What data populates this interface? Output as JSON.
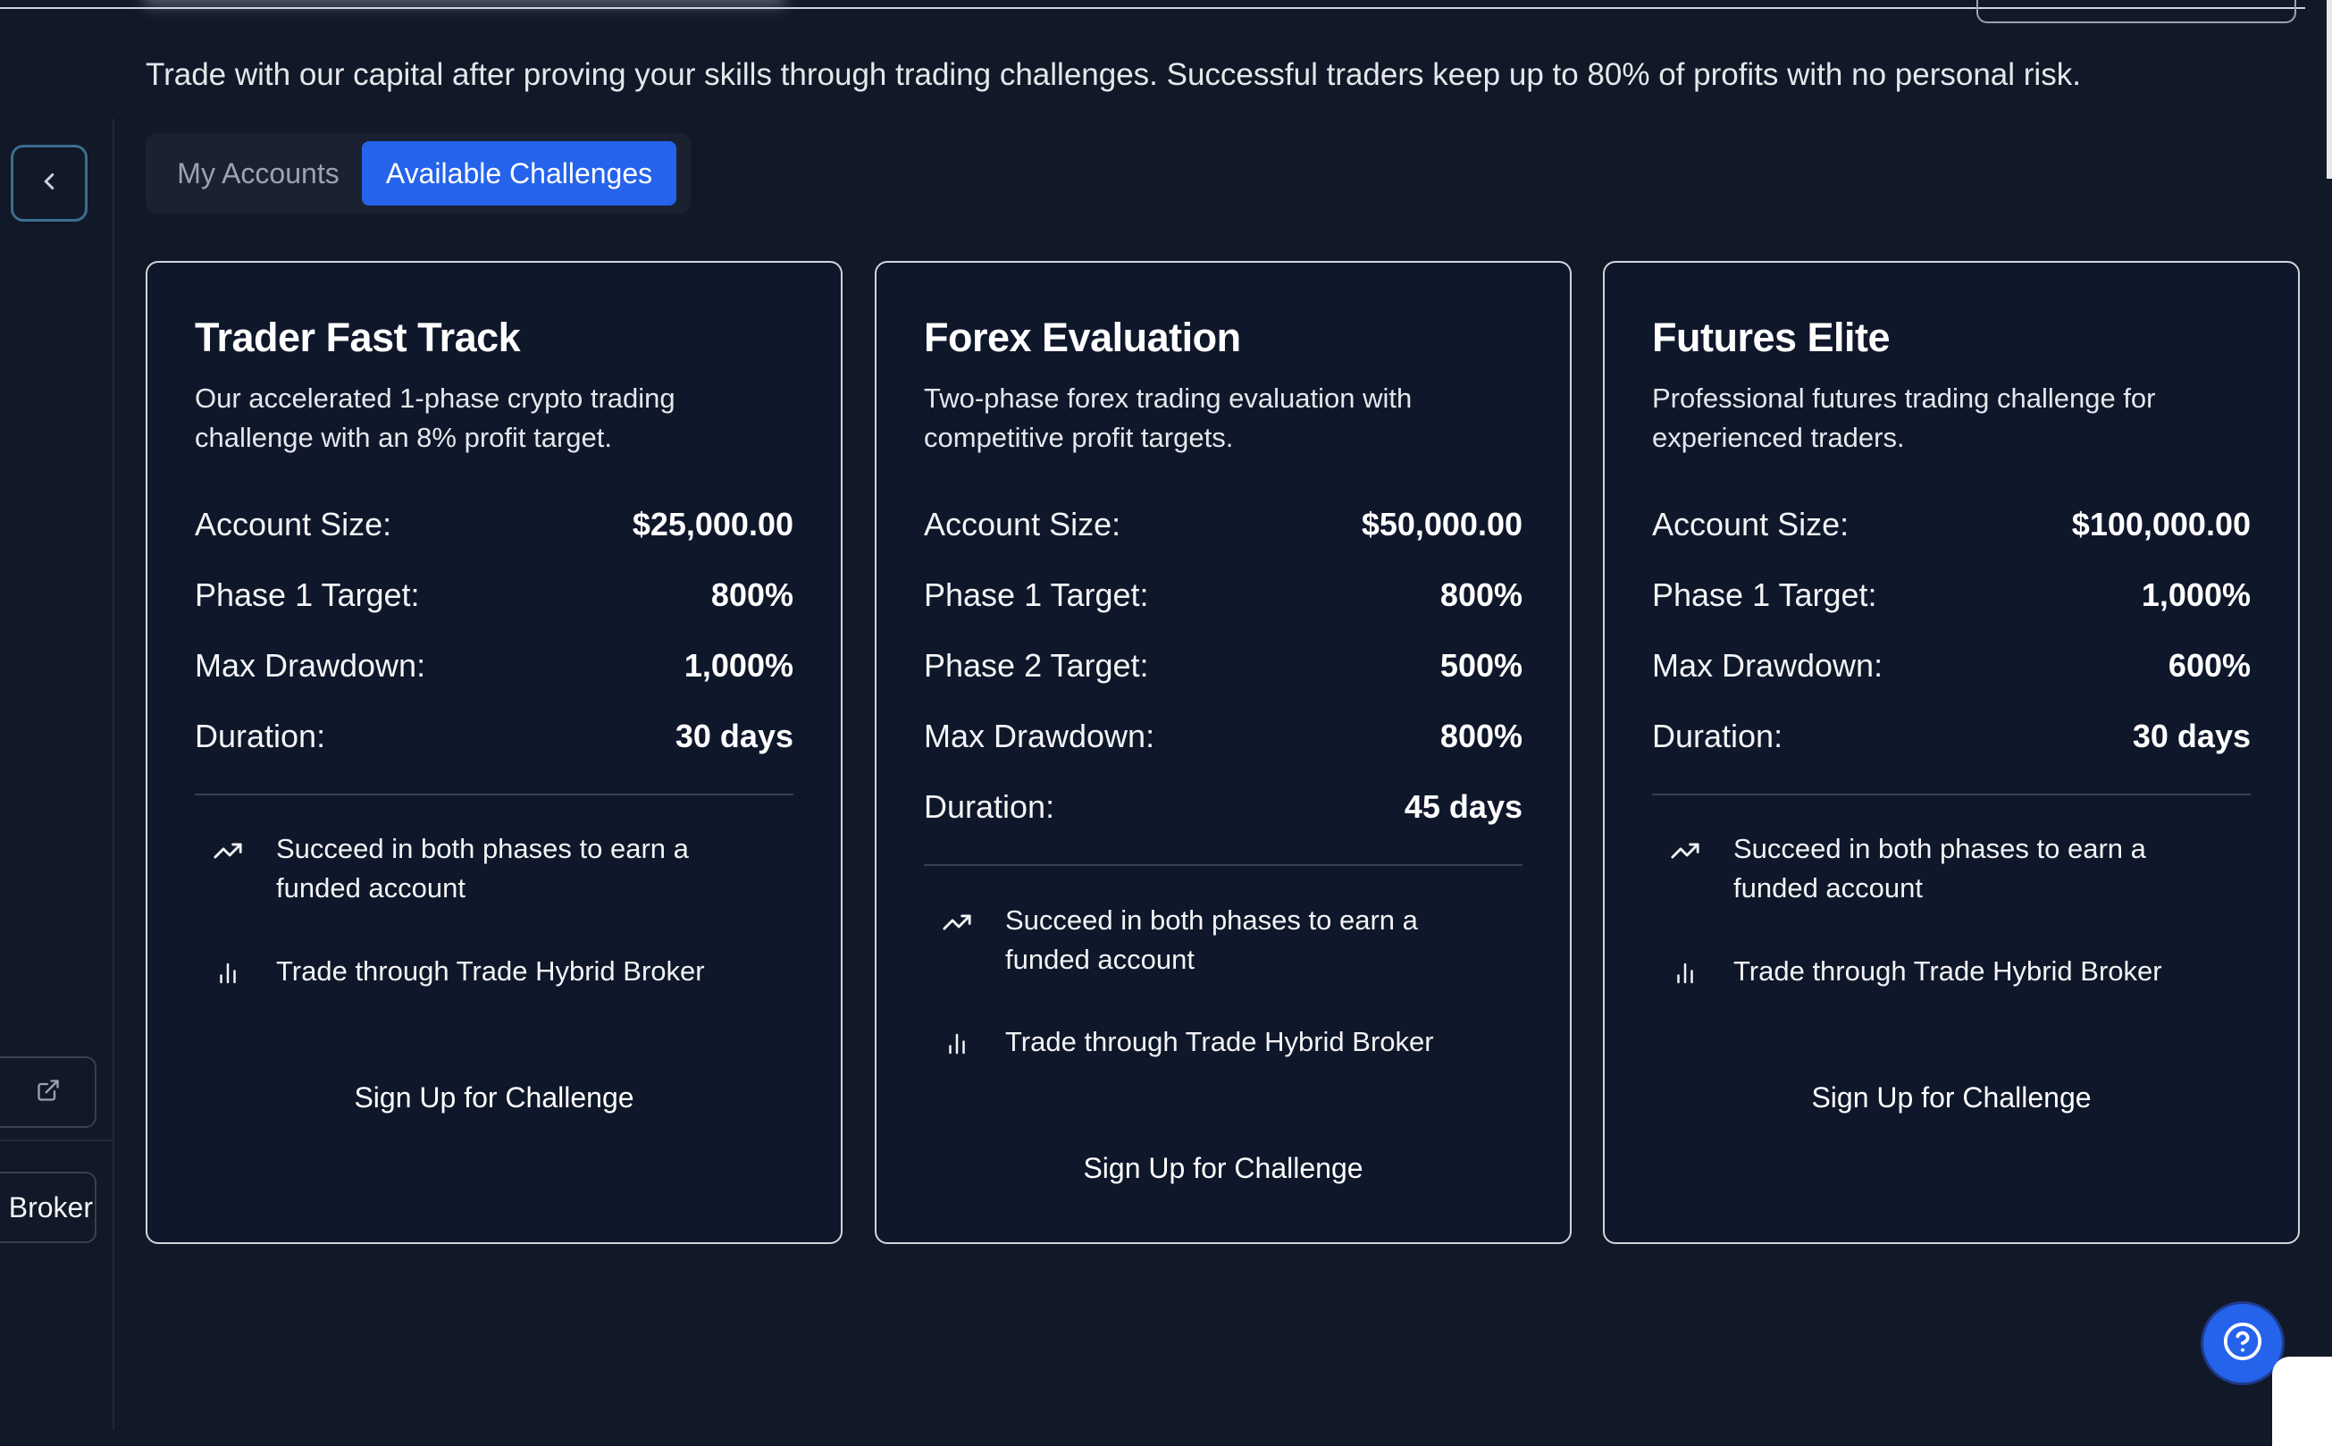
{
  "page": {
    "intro": "Trade with our capital after proving your skills through trading challenges. Successful traders keep up to 80% of profits with no personal risk."
  },
  "sidebar": {
    "broker_label": "Broker"
  },
  "tabs": [
    {
      "label": "My Accounts",
      "active": false
    },
    {
      "label": "Available Challenges",
      "active": true
    }
  ],
  "cards": [
    {
      "title": "Trader Fast Track",
      "description": "Our accelerated 1-phase crypto trading challenge with an 8% profit target.",
      "rows": [
        {
          "label": "Account Size:",
          "value": "$25,000.00"
        },
        {
          "label": "Phase 1 Target:",
          "value": "800%"
        },
        {
          "label": "Max Drawdown:",
          "value": "1,000%"
        },
        {
          "label": "Duration:",
          "value": "30 days"
        }
      ],
      "features": [
        {
          "icon": "trending-up-icon",
          "text": "Succeed in both phases to earn a funded account"
        },
        {
          "icon": "bar-chart-icon",
          "text": "Trade through Trade Hybrid Broker"
        }
      ],
      "signup_label": "Sign Up for Challenge"
    },
    {
      "title": "Forex Evaluation",
      "description": "Two-phase forex trading evaluation with competitive profit targets.",
      "rows": [
        {
          "label": "Account Size:",
          "value": "$50,000.00"
        },
        {
          "label": "Phase 1 Target:",
          "value": "800%"
        },
        {
          "label": "Phase 2 Target:",
          "value": "500%"
        },
        {
          "label": "Max Drawdown:",
          "value": "800%"
        },
        {
          "label": "Duration:",
          "value": "45 days"
        }
      ],
      "features": [
        {
          "icon": "trending-up-icon",
          "text": "Succeed in both phases to earn a funded account"
        },
        {
          "icon": "bar-chart-icon",
          "text": "Trade through Trade Hybrid Broker"
        }
      ],
      "signup_label": "Sign Up for Challenge"
    },
    {
      "title": "Futures Elite",
      "description": "Professional futures trading challenge for experienced traders.",
      "rows": [
        {
          "label": "Account Size:",
          "value": "$100,000.00"
        },
        {
          "label": "Phase 1 Target:",
          "value": "1,000%"
        },
        {
          "label": "Max Drawdown:",
          "value": "600%"
        },
        {
          "label": "Duration:",
          "value": "30 days"
        }
      ],
      "features": [
        {
          "icon": "trending-up-icon",
          "text": "Succeed in both phases to earn a funded account"
        },
        {
          "icon": "bar-chart-icon",
          "text": "Trade through Trade Hybrid Broker"
        }
      ],
      "signup_label": "Sign Up for Challenge"
    }
  ],
  "icons": {
    "collapse": "chevron-left-icon",
    "external": "external-link-icon",
    "help": "help-circle-icon"
  },
  "colors": {
    "background": "#111827",
    "accent": "#2563eb",
    "card_border": "#d1d5db"
  }
}
